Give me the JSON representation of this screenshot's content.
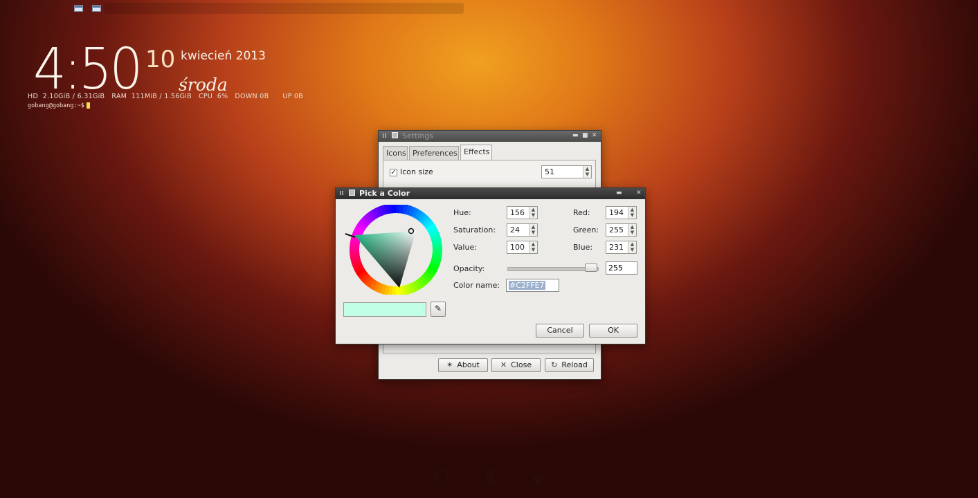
{
  "clock": {
    "time": "4:50",
    "day": "10",
    "month_year": "kwiecień 2013",
    "weekday": "środa"
  },
  "sysinfo": "HD  2.10GiB / 6.31GiB   RAM  111MiB / 1.56GiB   CPU  6%   DOWN 0B      UP 0B",
  "terminal": {
    "prompt": "gobang@gobang:~$"
  },
  "settings_window": {
    "title": "Settings",
    "tabs": [
      "Icons",
      "Preferences",
      "Effects"
    ],
    "active_tab": "Effects",
    "rows": [
      {
        "label": "Icon size",
        "checked": true,
        "value": "51"
      }
    ],
    "buttons": {
      "about": "About",
      "close": "Close",
      "reload": "Reload"
    }
  },
  "color_dialog": {
    "title": "Pick a Color",
    "hue": {
      "label": "Hue:",
      "value": "156"
    },
    "saturation": {
      "label": "Saturation:",
      "value": "24"
    },
    "value": {
      "label": "Value:",
      "value": "100"
    },
    "red": {
      "label": "Red:",
      "value": "194"
    },
    "green": {
      "label": "Green:",
      "value": "255"
    },
    "blue": {
      "label": "Blue:",
      "value": "231"
    },
    "opacity": {
      "label": "Opacity:",
      "value": "255",
      "level": 1.0
    },
    "color_name": {
      "label": "Color name:",
      "value": "#C2FFE7"
    },
    "current_color": "#C2FFE7",
    "cancel": "Cancel",
    "ok": "OK"
  },
  "icons": {
    "tray": [
      "window-icon",
      "window-icon"
    ],
    "dock": [
      "opera-icon",
      "app-icon",
      "feather-icon"
    ]
  }
}
